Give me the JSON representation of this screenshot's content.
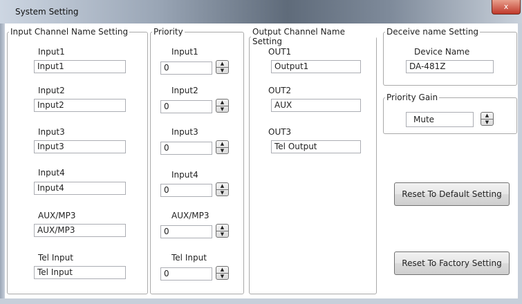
{
  "window": {
    "title": "System Setting",
    "close_glyph": "x"
  },
  "input_names": {
    "legend": "Input Channel Name Setting",
    "rows": [
      {
        "label": "Input1",
        "value": "Input1"
      },
      {
        "label": "Input2",
        "value": "Input2"
      },
      {
        "label": "Input3",
        "value": "Input3"
      },
      {
        "label": "Input4",
        "value": "Input4"
      },
      {
        "label": "AUX/MP3",
        "value": "AUX/MP3"
      },
      {
        "label": "Tel Input",
        "value": "Tel Input"
      }
    ]
  },
  "priority": {
    "legend": "Priority",
    "rows": [
      {
        "label": "Input1",
        "value": "0"
      },
      {
        "label": "Input2",
        "value": "0"
      },
      {
        "label": "Input3",
        "value": "0"
      },
      {
        "label": "Input4",
        "value": "0"
      },
      {
        "label": "AUX/MP3",
        "value": "0"
      },
      {
        "label": "Tel Input",
        "value": "0"
      }
    ]
  },
  "output_names": {
    "legend": "Output Channel Name Setting",
    "rows": [
      {
        "label": "OUT1",
        "value": "Output1"
      },
      {
        "label": "OUT2",
        "value": "AUX"
      },
      {
        "label": "OUT3",
        "value": "Tel Output"
      }
    ]
  },
  "device": {
    "legend": "Deceive name Setting",
    "label": "Device Name",
    "value": "DA-481Z"
  },
  "priority_gain": {
    "legend": "Priority Gain",
    "value": "Mute"
  },
  "buttons": {
    "reset_default": "Reset To Default Setting",
    "reset_factory": "Reset To Factory Setting"
  },
  "spinner": {
    "up": "▲",
    "down": "▼"
  }
}
